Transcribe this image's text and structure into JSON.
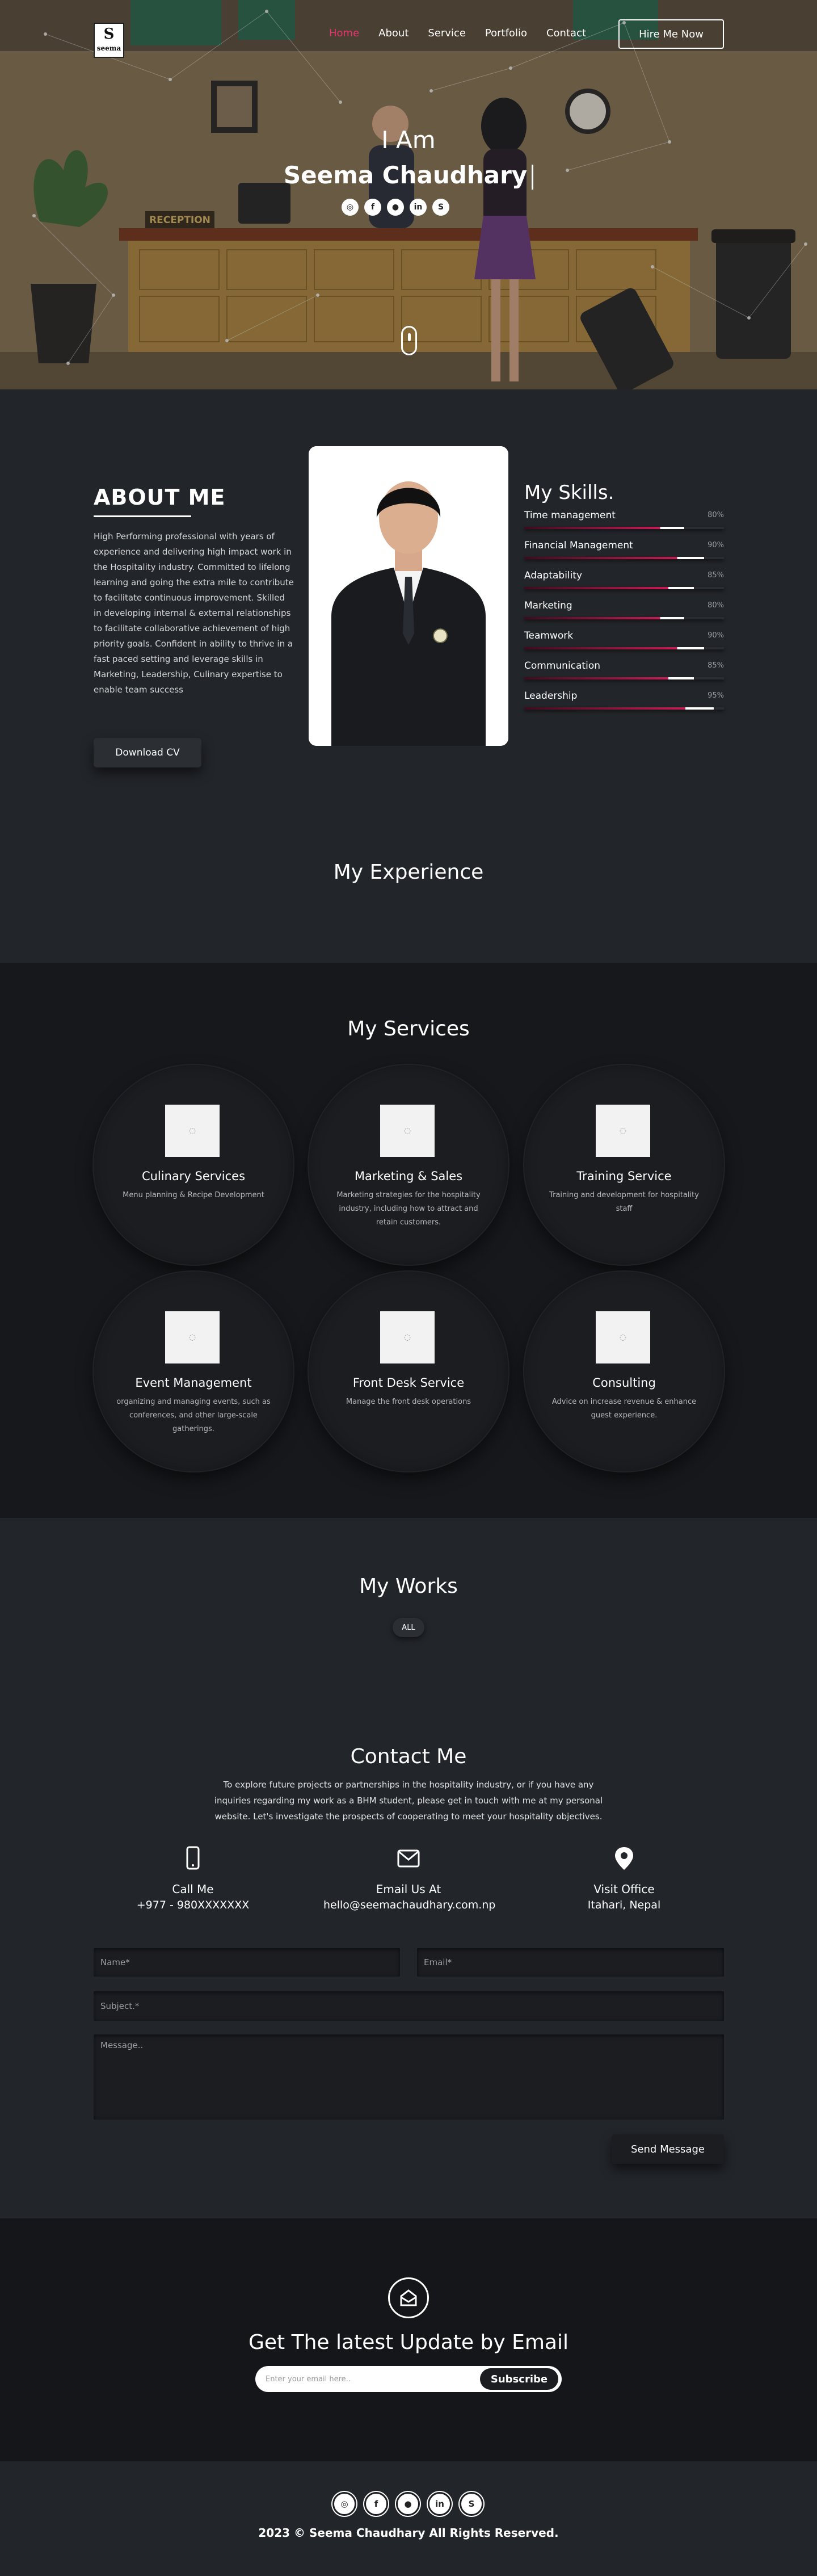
{
  "logo": {
    "line1": "S",
    "line2": "seema"
  },
  "nav": {
    "items": [
      {
        "label": "Home"
      },
      {
        "label": "About"
      },
      {
        "label": "Service"
      },
      {
        "label": "Portfolio"
      },
      {
        "label": "Contact"
      }
    ],
    "hire_label": "Hire Me Now"
  },
  "hero": {
    "reception_sign": "RECEPTION",
    "greeting": "I Am",
    "name": "Seema Chaudhary",
    "social_icons": [
      "instagram-icon",
      "facebook-icon",
      "user-icon",
      "linkedin-icon",
      "skype-icon"
    ]
  },
  "about": {
    "title": "ABOUT ME",
    "text": "High Performing professional with years of experience and delivering high impact work in the Hospitality industry. Committed to lifelong learning and going the extra mile to contribute to facilitate continuous improvement. Skilled in developing internal & external relationships to facilitate collaborative achievement of high priority goals. Confident in ability to thrive in a fast paced setting and leverage skills in Marketing, Leadership, Culinary expertise to enable team success",
    "download_label": "Download CV"
  },
  "skills": {
    "title": "My Skills.",
    "items": [
      {
        "label": "Time management",
        "pct_text": "80%",
        "value": 80
      },
      {
        "label": "Financial Management",
        "pct_text": "90%",
        "value": 90
      },
      {
        "label": "Adaptability",
        "pct_text": "85%",
        "value": 85
      },
      {
        "label": "Marketing",
        "pct_text": "80%",
        "value": 80
      },
      {
        "label": "Teamwork",
        "pct_text": "90%",
        "value": 90
      },
      {
        "label": "Communication",
        "pct_text": "85%",
        "value": 85
      },
      {
        "label": "Leadership",
        "pct_text": "95%",
        "value": 95
      }
    ]
  },
  "experience": {
    "title": "My Experience"
  },
  "services": {
    "title": "My Services",
    "items": [
      {
        "title": "Culinary Services",
        "desc": "Menu planning & Recipe Development"
      },
      {
        "title": "Marketing & Sales",
        "desc": "Marketing strategies for the hospitality industry, including how to attract and retain customers."
      },
      {
        "title": "Training Service",
        "desc": "Training and development for hospitality staff"
      },
      {
        "title": "Event Management",
        "desc": "organizing and managing events, such as conferences, and other large-scale gatherings."
      },
      {
        "title": "Front Desk Service",
        "desc": "Manage the front desk operations"
      },
      {
        "title": "Consulting",
        "desc": "Advice on increase revenue & enhance guest experience."
      }
    ]
  },
  "works": {
    "title": "My Works",
    "filter_all": "ALL"
  },
  "contact": {
    "title": "Contact Me",
    "intro": "To explore future projects or partnerships in the hospitality industry, or if you have any inquiries regarding my work as a BHM student, please get in touch with me at my personal website. Let's investigate the prospects of cooperating to meet your hospitality objectives.",
    "info": [
      {
        "icon": "phone-icon",
        "title": "Call Me",
        "value": "+977 - 980XXXXXXX"
      },
      {
        "icon": "envelope-icon",
        "title": "Email Us At",
        "value": "hello@seemachaudhary.com.np"
      },
      {
        "icon": "map-pin-icon",
        "title": "Visit Office",
        "value": "Itahari, Nepal"
      }
    ],
    "form": {
      "name_placeholder": "Name*",
      "email_placeholder": "Email*",
      "subject_placeholder": "Subject.*",
      "message_placeholder": "Message..",
      "send_label": "Send Message"
    }
  },
  "newsletter": {
    "title": "Get The latest Update by Email",
    "placeholder": "Enter your email here..",
    "subscribe_label": "Subscribe"
  },
  "footer": {
    "social_icons": [
      "instagram-icon",
      "facebook-icon",
      "user-icon",
      "linkedin-icon",
      "skype-icon"
    ],
    "copyright": "2023 © Seema Chaudhary All Rights Reserved."
  },
  "colors": {
    "accent": "#e8356d",
    "bg": "#22252a",
    "dark": "#17181c"
  }
}
